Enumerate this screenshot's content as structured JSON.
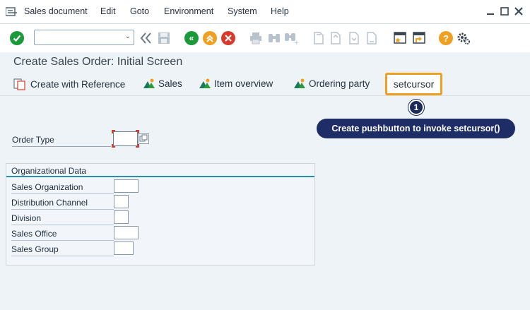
{
  "menu": {
    "items": [
      "Sales document",
      "Edit",
      "Goto",
      "Environment",
      "System",
      "Help"
    ]
  },
  "toolbar": {
    "command_value": ""
  },
  "title": "Create Sales Order: Initial Screen",
  "app_toolbar": {
    "create_with_reference": "Create with Reference",
    "sales": "Sales",
    "item_overview": "Item overview",
    "ordering_party": "Ordering party",
    "setcursor": "setcursor"
  },
  "annotation": {
    "number": "1",
    "callout": "Create pushbutton to invoke setcursor()"
  },
  "form": {
    "order_type_label": "Order Type",
    "order_type_value": "",
    "org_group_title": "Organizational Data",
    "org_fields": [
      {
        "label": "Sales Organization",
        "value": ""
      },
      {
        "label": "Distribution Channel",
        "value": ""
      },
      {
        "label": "Division",
        "value": ""
      },
      {
        "label": "Sales Office",
        "value": ""
      },
      {
        "label": "Sales Group",
        "value": ""
      }
    ]
  },
  "colors": {
    "highlight": "#f0a020",
    "callout_bg": "#1f2d66",
    "enter_green": "#1a9a3a",
    "back_green": "#1a9a3a",
    "exit_orange": "#f0a020",
    "cancel_red": "#d83a2a",
    "help_orange": "#f0a020"
  }
}
